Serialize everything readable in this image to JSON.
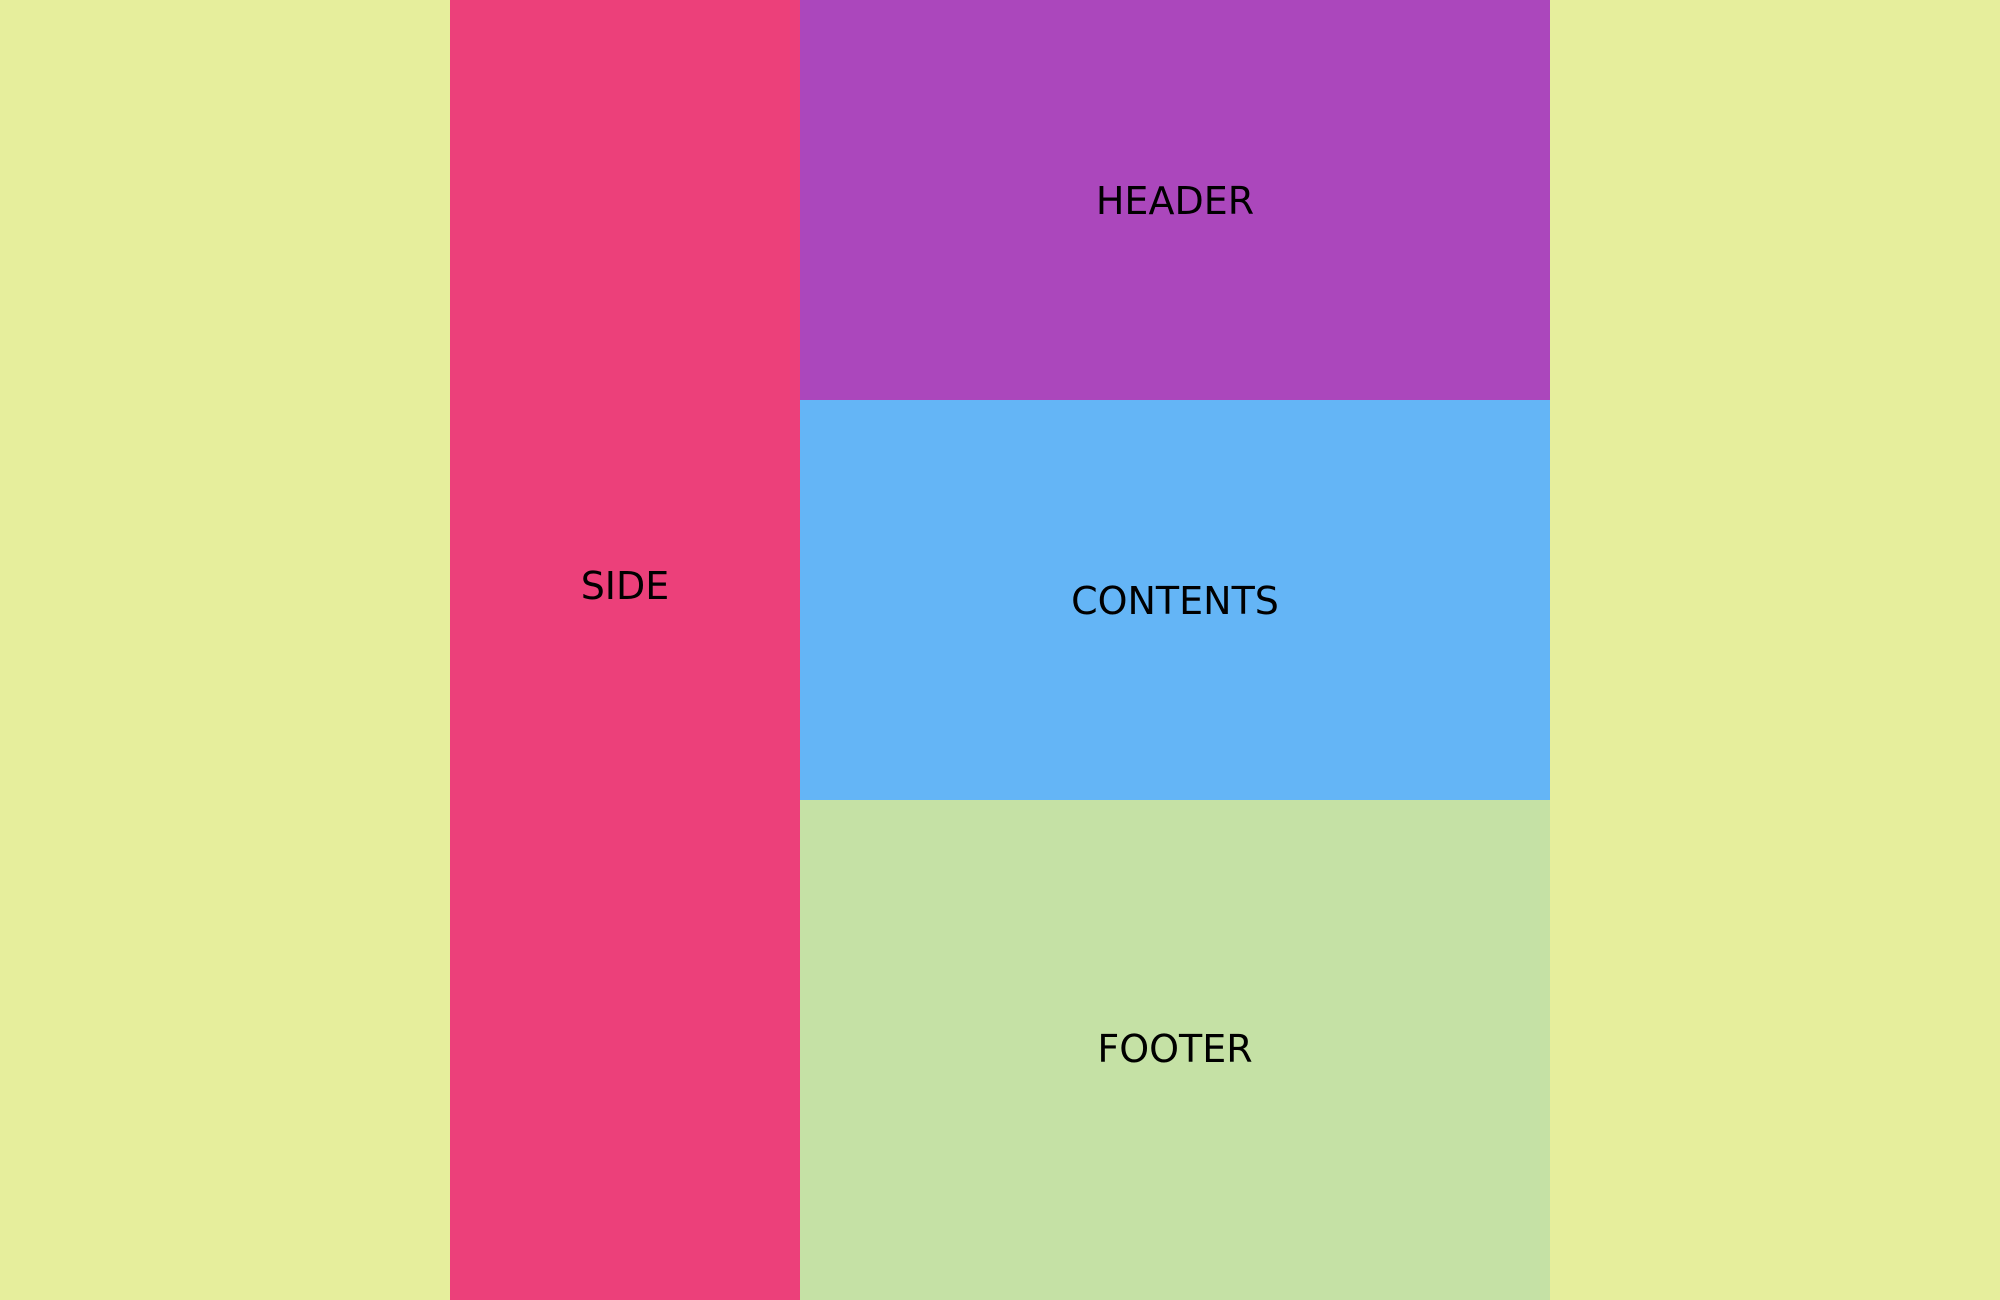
{
  "layout": {
    "side": {
      "label": "SIDE"
    },
    "header": {
      "label": "HEADER"
    },
    "contents": {
      "label": "CONTENTS"
    },
    "footer": {
      "label": "FOOTER"
    }
  },
  "colors": {
    "gutter": "#E6EE9C",
    "side": "#EC407A",
    "header": "#AB47BC",
    "contents": "#64B5F6",
    "footer": "#C5E1A5",
    "text": "#000000"
  }
}
